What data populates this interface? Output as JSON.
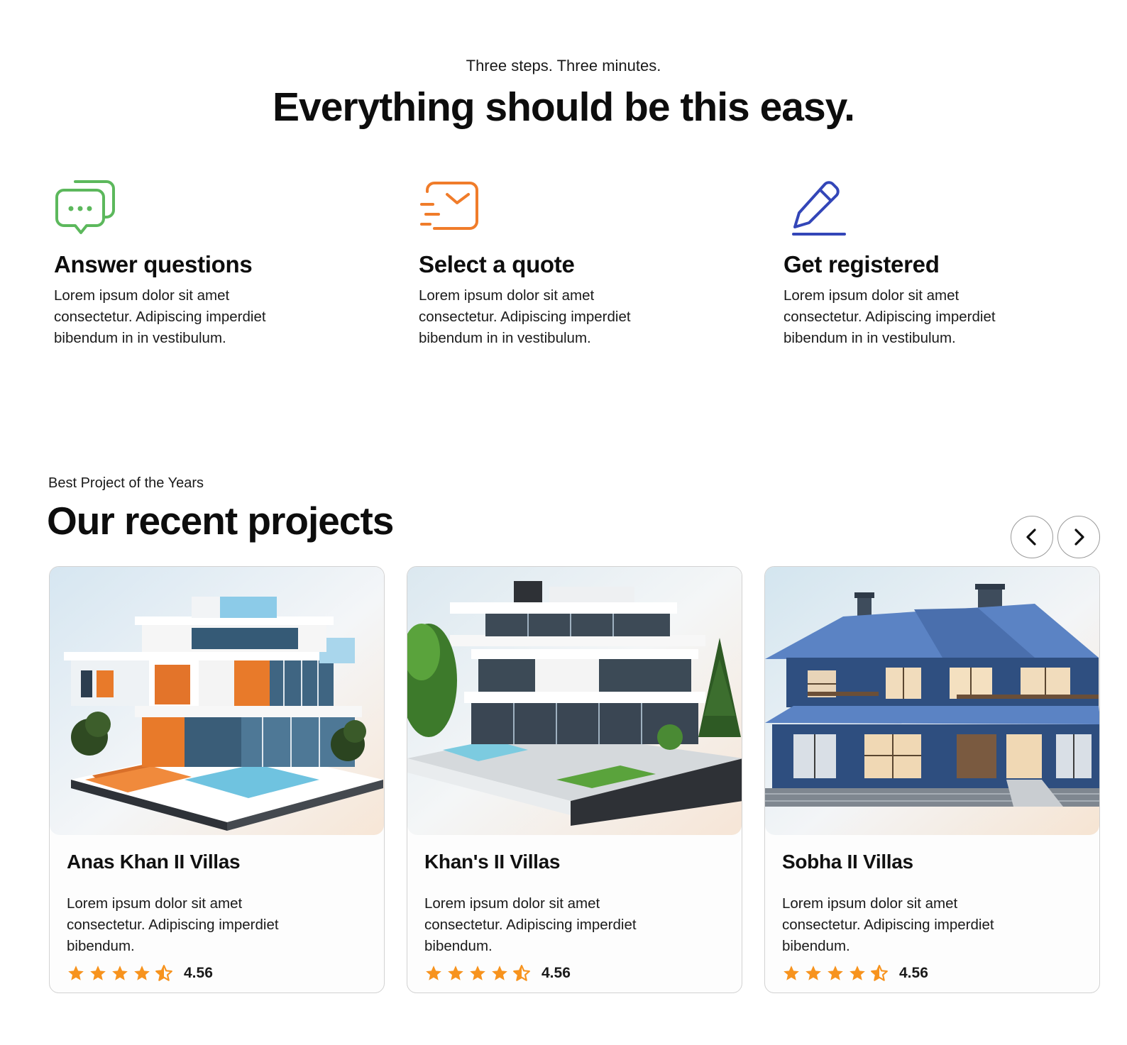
{
  "hero": {
    "eyebrow": "Three steps. Three minutes.",
    "headline": "Everything should be this easy."
  },
  "steps": [
    {
      "icon": "chat-bubbles-icon",
      "color": "#5cb85c",
      "title": "Answer questions",
      "desc": "Lorem ipsum dolor sit amet consectetur. Adipiscing imperdiet bibendum in in vestibulum."
    },
    {
      "icon": "fast-mail-icon",
      "color": "#f07c2a",
      "title": "Select a quote",
      "desc": "Lorem ipsum dolor sit amet consectetur. Adipiscing imperdiet bibendum in in vestibulum."
    },
    {
      "icon": "pencil-icon",
      "color": "#3346b8",
      "title": "Get registered",
      "desc": "Lorem ipsum dolor sit amet consectetur. Adipiscing imperdiet bibendum in in vestibulum."
    }
  ],
  "projects": {
    "eyebrow": "Best Project of the Years",
    "title": "Our recent projects",
    "prev_icon": "chevron-left-icon",
    "next_icon": "chevron-right-icon",
    "star_color": "#f7931e",
    "cards": [
      {
        "name": "Anas Khan II Villas",
        "desc": "Lorem ipsum dolor sit amet consectetur. Adipiscing imperdiet bibendum.",
        "rating": "4.56",
        "stars": 4.5
      },
      {
        "name": "Khan's II Villas",
        "desc": "Lorem ipsum dolor sit amet consectetur. Adipiscing imperdiet bibendum.",
        "rating": "4.56",
        "stars": 4.5
      },
      {
        "name": "Sobha II Villas",
        "desc": "Lorem ipsum dolor sit amet consectetur. Adipiscing imperdiet bibendum.",
        "rating": "4.56",
        "stars": 4.5
      }
    ]
  }
}
